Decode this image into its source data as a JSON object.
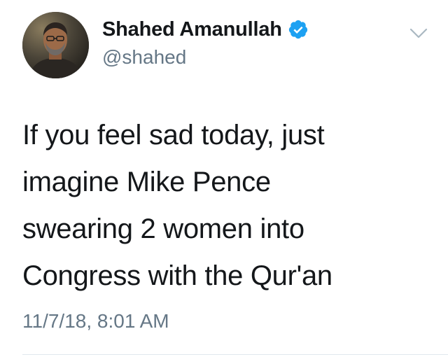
{
  "tweet": {
    "author": {
      "display_name": "Shahed Amanullah",
      "handle": "@shahed",
      "verified": true,
      "avatar": "user-avatar-photo"
    },
    "menu_icon": "chevron-down-icon",
    "text_lines": [
      "If you feel sad today, just",
      "imagine Mike Pence",
      "swearing 2 women into",
      "Congress with the Qur'an"
    ],
    "timestamp": "11/7/18, 8:01 AM"
  },
  "colors": {
    "text_primary": "#14171a",
    "text_secondary": "#657786",
    "verified_blue": "#1da1f2",
    "divider": "#e1e8ed"
  }
}
